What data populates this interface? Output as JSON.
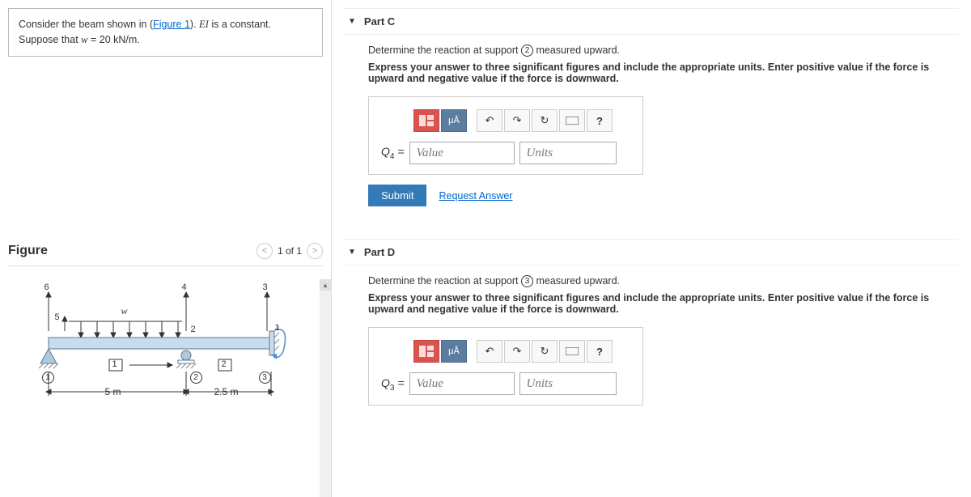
{
  "problem": {
    "intro_prefix": "Consider the beam shown in (",
    "figure_link": "Figure 1",
    "intro_suffix": ").",
    "ei_text": "EI",
    "ei_suffix": " is a constant.",
    "suppose_prefix": "Suppose that ",
    "var_w": "w",
    "equals": " = 20 kN/m."
  },
  "figure": {
    "title": "Figure",
    "pager": "1 of 1",
    "labels": {
      "l6": "6",
      "l5": "5",
      "l4": "4",
      "l3": "3",
      "l2": "2",
      "l1": "1",
      "w": "w",
      "n1": "1",
      "n2": "2",
      "s1": "1",
      "s2": "2",
      "s3": "3",
      "dim1": "5 m",
      "dim2": "2.5 m"
    }
  },
  "toolbar": {
    "mua": "μÅ",
    "help": "?"
  },
  "partC": {
    "title": "Part C",
    "instruct_prefix": "Determine the reaction at support ",
    "support_num": "2",
    "instruct_suffix": " measured upward.",
    "bold": "Express your answer to three significant figures and include the appropriate units. Enter positive value if the force is upward and negative value if the force is downward.",
    "var": "Q",
    "sub": "4",
    "eq": " = ",
    "value_ph": "Value",
    "units_ph": "Units",
    "submit": "Submit",
    "request": "Request Answer"
  },
  "partD": {
    "title": "Part D",
    "instruct_prefix": "Determine the reaction at support ",
    "support_num": "3",
    "instruct_suffix": " measured upward.",
    "bold": "Express your answer to three significant figures and include the appropriate units. Enter positive value if the force is upward and negative value if the force is downward.",
    "var": "Q",
    "sub": "3",
    "eq": " = ",
    "value_ph": "Value",
    "units_ph": "Units"
  }
}
